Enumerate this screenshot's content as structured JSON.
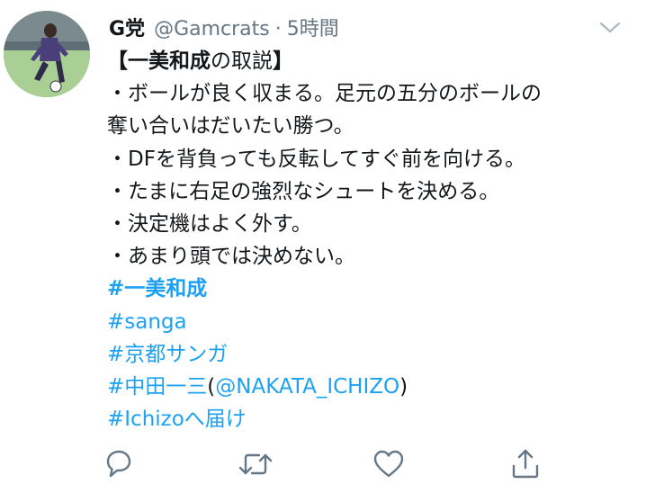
{
  "tweet": {
    "display_name": "G党",
    "handle": "@Gamcrats",
    "separator": "·",
    "time": "5時間",
    "title_open": "【",
    "title_bold": "一美和成",
    "title_rest": "の取説",
    "title_close": "】",
    "lines": [
      "・ボールが良く収まる。足元の五分のボールの",
      "奪い合いはだいたい勝つ。",
      "・DFを背負っても反転してすぐ前を向ける。",
      "・たまに右足の強烈なシュートを決める。",
      "・決定機はよく外す。",
      "・あまり頭では決めない。"
    ],
    "hashtags": {
      "ichimi": "#一美和成",
      "sanga": "#sanga",
      "kyoto": "#京都サンガ",
      "nakata": "#中田一三",
      "nakata_open": "(",
      "nakata_mention": "@NAKATA_ICHIZO",
      "nakata_close": ")",
      "ichizo": "#Ichizoへ届け"
    }
  },
  "actions": {
    "reply": "reply-icon",
    "retweet": "retweet-icon",
    "like": "heart-icon",
    "share": "share-icon"
  },
  "colors": {
    "link": "#1da1f2",
    "secondary_text": "#657786",
    "icon": "#657786",
    "text": "#14171a"
  }
}
